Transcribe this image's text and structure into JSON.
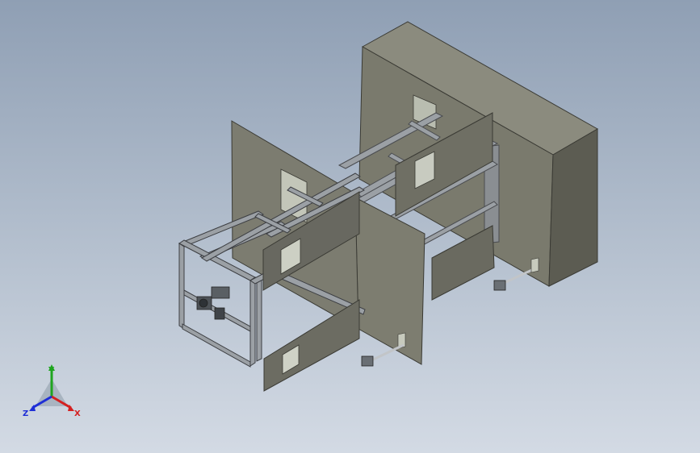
{
  "viewport": {
    "background_top": "#8f9fb4",
    "background_bottom": "#d3dae4"
  },
  "model": {
    "panel_color": "#7a7a6d",
    "frame_color": "#8a8e92"
  },
  "triad": {
    "x_label": "X",
    "y_label": "Y",
    "z_label": "Z",
    "x_color": "#d42020",
    "y_color": "#1fa51f",
    "z_color": "#1e2ed6"
  }
}
